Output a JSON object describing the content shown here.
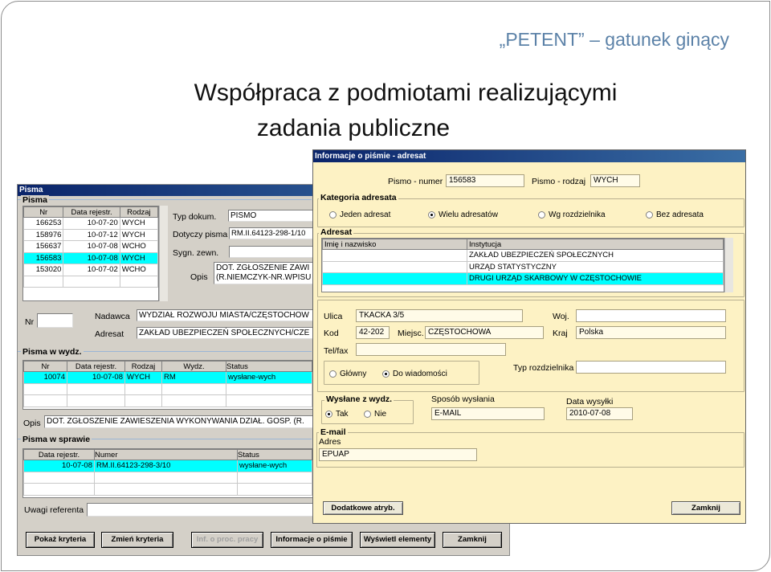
{
  "slide": {
    "header_tag": "„PETENT” – gatunek ginący",
    "title_line1": "Współpraca z podmiotami realizującymi",
    "title_line2": "zadania publiczne"
  },
  "pisma_window": {
    "title": "Pisma",
    "group_pisma": "Pisma",
    "columns": [
      "Nr",
      "Data rejestr.",
      "Rodzaj"
    ],
    "rows": [
      [
        "166253",
        "10-07-20",
        "WYCH"
      ],
      [
        "158976",
        "10-07-12",
        "WYCH"
      ],
      [
        "156637",
        "10-07-08",
        "WCHO"
      ],
      [
        "156583",
        "10-07-08",
        "WYCH"
      ],
      [
        "153020",
        "10-07-02",
        "WCHO"
      ]
    ],
    "typ_dokum_label": "Typ dokum.",
    "typ_dokum_value": "PISMO",
    "dotyczy_label": "Dotyczy pisma",
    "dotyczy_value": "RM.II.64123-298-1/10",
    "sygn_label": "Sygn. zewn.",
    "opis_label": "Opis",
    "opis_line1": "DOT. ZGŁOSZENIE ZAWI",
    "opis_line2": "(R.NIEMCZYK-NR.WPISU",
    "nr_label": "Nr",
    "nadawca_label": "Nadawca",
    "nadawca_value": "WYDZIAŁ ROZWOJU MIASTA/CZĘSTOCHOW",
    "adresat_label": "Adresat",
    "adresat_value": "ZAKŁAD UBEZPIECZEŃ SPOŁECZNYCH/CZE",
    "group_wydz": "Pisma w wydz.",
    "wydz_columns": [
      "Nr",
      "Data rejestr.",
      "Rodzaj",
      "Wydz.",
      "Status"
    ],
    "wydz_rows": [
      [
        "10074",
        "10-07-08",
        "WYCH",
        "RM",
        "wysłane-wych"
      ]
    ],
    "opis2_label": "Opis",
    "opis2_value": "DOT. ZGŁOSZENIE ZAWIESZENIA WYKONYWANIA DZIAŁ. GOSP. (R.",
    "group_sprawie": "Pisma w sprawie",
    "sprawie_columns": [
      "Data rejestr.",
      "Numer",
      "Status"
    ],
    "sprawie_rows": [
      [
        "10-07-08",
        "RM.II.64123-298-3/10",
        "wysłane-wych"
      ]
    ],
    "uwagi_label": "Uwagi referenta",
    "buttons": [
      "Pokaż kryteria",
      "Zmień kryteria",
      "Inf. o proc. pracy",
      "Informacje o piśmie",
      "Wyświetl elementy",
      "Zamknij"
    ]
  },
  "info_window": {
    "title": "Informacje o piśmie - adresat",
    "pismo_numer_label": "Pismo - numer",
    "pismo_numer_value": "156583",
    "pismo_rodzaj_label": "Pismo - rodzaj",
    "pismo_rodzaj_value": "WYCH",
    "kategoria_title": "Kategoria adresata",
    "kategoria_options": [
      "Jeden adresat",
      "Wielu adresatów",
      "Wg rozdzielnika",
      "Bez adresata"
    ],
    "adresat_title": "Adresat",
    "adresat_columns": [
      "Imię i nazwisko",
      "Instytucja"
    ],
    "adresat_rows": [
      "ZAKŁAD UBEZPIECZEŃ SPOŁECZNYCH",
      "URZĄD STATYSTYCZNY",
      "DRUGI URZĄD SKARBOWY W CZĘSTOCHOWIE"
    ],
    "ulica_label": "Ulica",
    "ulica_value": "TKACKA 3/5",
    "woj_label": "Woj.",
    "kod_label": "Kod",
    "kod_value": "42-202",
    "miejsc_label": "Miejsc.",
    "miejsc_value": "CZĘSTOCHOWA",
    "kraj_label": "Kraj",
    "kraj_value": "Polska",
    "telfax_label": "Tel/fax",
    "typ_rozdz_label": "Typ rozdzielnika",
    "glowny_label": "Główny",
    "do_wiad_label": "Do wiadomości",
    "wyslane_title": "Wysłane z wydz.",
    "tak_label": "Tak",
    "nie_label": "Nie",
    "sposob_label": "Sposób wysłania",
    "sposob_value": "E-MAIL",
    "data_label": "Data wysyłki",
    "data_value": "2010-07-08",
    "email_title": "E-mail",
    "adres_label": "Adres",
    "adres_value": "EPUAP",
    "btn_dodatkowe": "Dodatkowe atryb.",
    "btn_zamknij": "Zamknij"
  }
}
